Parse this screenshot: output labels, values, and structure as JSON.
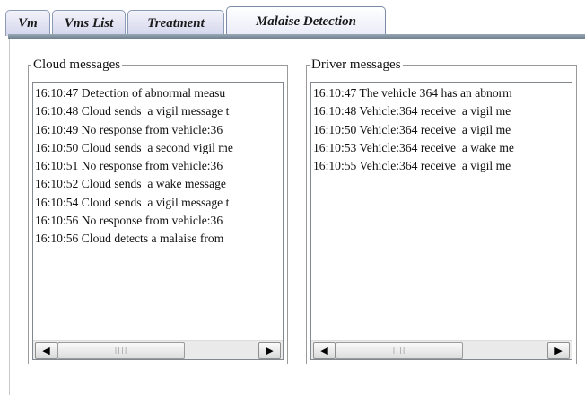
{
  "tabs": [
    {
      "label": "Vm"
    },
    {
      "label": "Vms List"
    },
    {
      "label": "Treatment"
    },
    {
      "label": "Malaise Detection"
    }
  ],
  "active_tab": "Malaise Detection",
  "cloud": {
    "legend": "Cloud messages",
    "lines": [
      "16:10:47 Detection of abnormal measu",
      "16:10:48 Cloud sends  a vigil message t",
      "16:10:49 No response from vehicle:36",
      "16:10:50 Cloud sends  a second vigil me",
      "16:10:51 No response from vehicle:36",
      "16:10:52 Cloud sends  a wake message",
      "16:10:54 Cloud sends  a vigil message t",
      "16:10:56 No response from vehicle:36",
      "16:10:56 Cloud detects a malaise from"
    ]
  },
  "driver": {
    "legend": "Driver messages",
    "lines": [
      "16:10:47 The vehicle 364 has an abnorm",
      "16:10:48 Vehicle:364 receive  a vigil me",
      "16:10:50 Vehicle:364 receive  a vigil me",
      "16:10:53 Vehicle:364 receive  a wake me",
      "16:10:55 Vehicle:364 receive  a vigil me"
    ]
  },
  "scrollbar": {
    "left_arrow": "◀",
    "right_arrow": "▶",
    "grip": "||||"
  },
  "colors": {
    "tab_bg": "#d3d5ec",
    "tab_rail": "#7d8e9c",
    "border": "#828790"
  }
}
